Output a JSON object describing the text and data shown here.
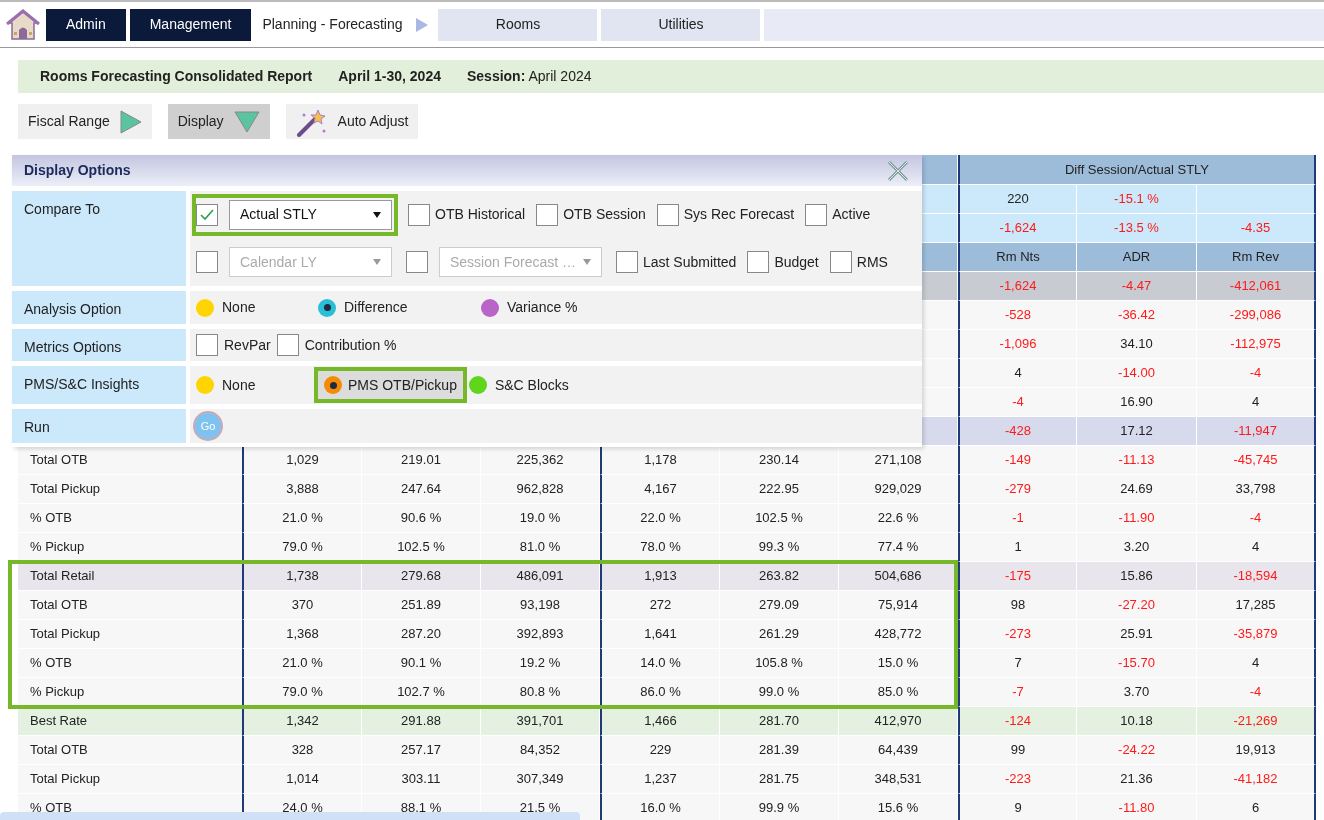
{
  "nav": [
    {
      "kind": "dark",
      "label": "Admin"
    },
    {
      "kind": "dark",
      "label": "Management"
    },
    {
      "kind": "breadcrumb",
      "label": "Planning - Forecasting"
    },
    {
      "kind": "light",
      "label": "Rooms"
    },
    {
      "kind": "light",
      "label": "Utilities"
    }
  ],
  "report_header": [
    "Rooms Forecasting Consolidated Report",
    "April 1-30, 2024",
    "**Session:** April 2024"
  ],
  "toolbar": [
    {
      "kind": "play",
      "label": "Fiscal Range",
      "selected": false
    },
    {
      "kind": "dropdown",
      "label": "Display",
      "selected": true
    },
    {
      "kind": "wand",
      "label": "Auto Adjust",
      "selected": false
    }
  ],
  "display_options": {
    "title": "Display Options",
    "compare_to": {
      "label": "Compare To",
      "lines": [
        [
          {
            "kind": "select",
            "checked": true,
            "value": "Actual STLY",
            "disabled": false,
            "highlighted": true
          },
          {
            "kind": "checkbox",
            "label": "OTB Historical",
            "checked": false
          },
          {
            "kind": "checkbox",
            "label": "OTB Session",
            "checked": false
          },
          {
            "kind": "checkbox",
            "label": "Sys Rec Forecast",
            "checked": false
          },
          {
            "kind": "checkbox",
            "label": "Active",
            "checked": false
          }
        ],
        [
          {
            "kind": "select",
            "checked": false,
            "value": "Calendar LY",
            "disabled": true,
            "highlighted": false
          },
          {
            "kind": "select",
            "checked": false,
            "value": "Session Forecast …",
            "disabled": true,
            "highlighted": false
          },
          {
            "kind": "checkbox",
            "label": "Last Submitted",
            "checked": false
          },
          {
            "kind": "checkbox",
            "label": "Budget",
            "checked": false
          },
          {
            "kind": "checkbox",
            "label": "RMS",
            "checked": false
          }
        ]
      ]
    },
    "analysis_option": {
      "label": "Analysis Option",
      "options": [
        {
          "label": "None",
          "color": "#ffd400",
          "selected": false,
          "highlighted": false
        },
        {
          "label": "Difference",
          "color": "#2bbfd6",
          "selected": true,
          "highlighted": false
        },
        {
          "label": "Variance %",
          "color": "#b864c9",
          "selected": false,
          "highlighted": false
        }
      ]
    },
    "metrics_options": {
      "label": "Metrics Options",
      "options": [
        {
          "label": "RevPar",
          "checked": false
        },
        {
          "label": "Contribution %",
          "checked": false
        }
      ]
    },
    "insights": {
      "label": "PMS/S&C Insights",
      "options": [
        {
          "label": "None",
          "color": "#ffd400",
          "selected": false,
          "highlighted": false
        },
        {
          "label": "PMS OTB/Pickup",
          "color": "#f58a07",
          "selected": true,
          "highlighted": true
        },
        {
          "label": "S&C Blocks",
          "color": "#5fd61c",
          "selected": false,
          "highlighted": false
        }
      ]
    },
    "run": {
      "label": "Run",
      "button": "Go"
    }
  },
  "table": {
    "diff_header": "Diff Session/Actual STLY",
    "upper_rows": [
      {
        "kind": "info",
        "cells": [
          "220",
          "-15.1 %"
        ]
      },
      {
        "kind": "info",
        "cells": [
          "-1,624",
          "-13.5 %",
          "-4.35"
        ]
      },
      {
        "kind": "header",
        "cells": [
          "Rm Nts",
          "ADR",
          "Rm Rev"
        ]
      },
      {
        "kind": "total",
        "cells": [
          "-1,624",
          "-4.47",
          "-412,061"
        ]
      },
      {
        "kind": "normal",
        "cells": [
          "-528",
          "-36.42",
          "-299,086"
        ]
      },
      {
        "kind": "normal",
        "cells": [
          "-1,096",
          "34.10",
          "-112,975"
        ]
      },
      {
        "kind": "normal",
        "cells": [
          "4",
          "-14.00",
          "-4"
        ]
      },
      {
        "kind": "normal",
        "cells": [
          "-4",
          "16.90",
          "4"
        ]
      },
      {
        "kind": "summary",
        "cells": [
          "-428",
          "17.12",
          "-11,947"
        ]
      }
    ],
    "sections": [
      {
        "highlighted": false,
        "rows": [
          {
            "kind": "normal",
            "label": "Total OTB",
            "cells": [
              "1,029",
              "219.01",
              "225,362",
              "1,178",
              "230.14",
              "271,108",
              "-149",
              "-11.13",
              "-45,745"
            ]
          },
          {
            "kind": "normal",
            "label": "Total Pickup",
            "cells": [
              "3,888",
              "247.64",
              "962,828",
              "4,167",
              "222.95",
              "929,029",
              "-279",
              "24.69",
              "33,798"
            ]
          },
          {
            "kind": "normal",
            "label": "% OTB",
            "cells": [
              "21.0 %",
              "90.6 %",
              "19.0 %",
              "22.0 %",
              "102.5 %",
              "22.6 %",
              "-1",
              "-11.90",
              "-4"
            ]
          },
          {
            "kind": "normal",
            "label": "% Pickup",
            "cells": [
              "79.0 %",
              "102.5 %",
              "81.0 %",
              "78.0 %",
              "99.3 %",
              "77.4 %",
              "1",
              "3.20",
              "4"
            ]
          }
        ]
      },
      {
        "highlighted": true,
        "rows": [
          {
            "kind": "retail",
            "label": "Total Retail",
            "cells": [
              "1,738",
              "279.68",
              "486,091",
              "1,913",
              "263.82",
              "504,686",
              "-175",
              "15.86",
              "-18,594"
            ]
          },
          {
            "kind": "normal",
            "label": "Total OTB",
            "cells": [
              "370",
              "251.89",
              "93,198",
              "272",
              "279.09",
              "75,914",
              "98",
              "-27.20",
              "17,285"
            ]
          },
          {
            "kind": "normal",
            "label": "Total Pickup",
            "cells": [
              "1,368",
              "287.20",
              "392,893",
              "1,641",
              "261.29",
              "428,772",
              "-273",
              "25.91",
              "-35,879"
            ]
          },
          {
            "kind": "normal",
            "label": "% OTB",
            "cells": [
              "21.0 %",
              "90.1 %",
              "19.2 %",
              "14.0 %",
              "105.8 %",
              "15.0 %",
              "7",
              "-15.70",
              "4"
            ]
          },
          {
            "kind": "normal",
            "label": "% Pickup",
            "cells": [
              "79.0 %",
              "102.7 %",
              "80.8 %",
              "86.0 %",
              "99.0 %",
              "85.0 %",
              "-7",
              "3.70",
              "-4"
            ]
          }
        ]
      },
      {
        "highlighted": false,
        "rows": [
          {
            "kind": "best",
            "label": "Best Rate",
            "cells": [
              "1,342",
              "291.88",
              "391,701",
              "1,466",
              "281.70",
              "412,970",
              "-124",
              "10.18",
              "-21,269"
            ]
          },
          {
            "kind": "normal",
            "label": "Total OTB",
            "cells": [
              "328",
              "257.17",
              "84,352",
              "229",
              "281.39",
              "64,439",
              "99",
              "-24.22",
              "19,913"
            ]
          },
          {
            "kind": "normal",
            "label": "Total Pickup",
            "cells": [
              "1,014",
              "303.11",
              "307,349",
              "1,237",
              "281.75",
              "348,531",
              "-223",
              "21.36",
              "-41,182"
            ]
          },
          {
            "kind": "normal",
            "label": "% OTB",
            "cells": [
              "24.0 %",
              "88.1 %",
              "21.5 %",
              "16.0 %",
              "99.9 %",
              "15.6 %",
              "9",
              "-11.80",
              "6"
            ]
          }
        ]
      }
    ]
  }
}
